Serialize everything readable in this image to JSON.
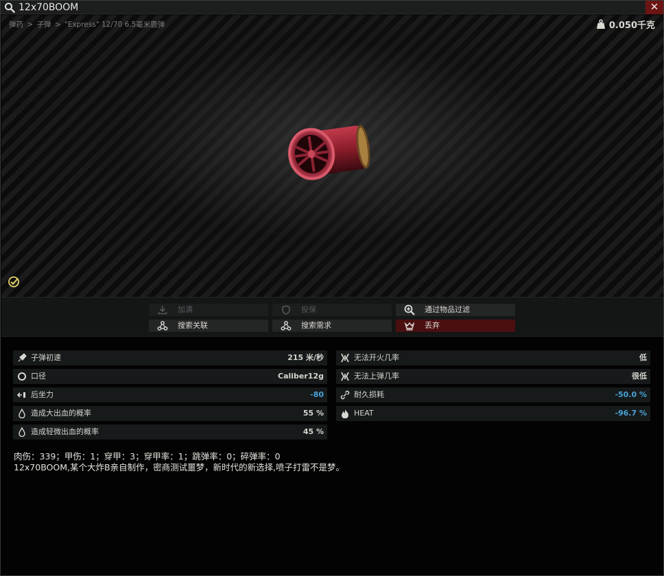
{
  "title": "12x70BOOM",
  "close_symbol": "✕",
  "breadcrumb": [
    "弹药",
    "子弹",
    "\"Express\" 12/70 6.5毫米鹿弹"
  ],
  "breadcrumb_sep": ">",
  "weight": "0.050千克",
  "actions": {
    "add": "加满",
    "insure": "投保",
    "filter": "通过物品过滤",
    "linked": "搜索关联",
    "required": "搜索需求",
    "discard": "丢弃"
  },
  "stats_left": [
    {
      "icon": "bullet-speed-icon",
      "label": "子弹初速",
      "value": "215 米/秒"
    },
    {
      "icon": "caliber-icon",
      "label": "口径",
      "value": "Caliber12g"
    },
    {
      "icon": "recoil-icon",
      "label": "后坐力",
      "value": "-80"
    },
    {
      "icon": "heavy-bleed-icon",
      "label": "造成大出血的概率",
      "value": "55 %"
    },
    {
      "icon": "light-bleed-icon",
      "label": "造成轻微出血的概率",
      "value": "45 %"
    }
  ],
  "stats_right": [
    {
      "icon": "misfire-icon",
      "label": "无法开火几率",
      "value": "低"
    },
    {
      "icon": "failure-to-feed-icon",
      "label": "无法上弹几率",
      "value": "很低"
    },
    {
      "icon": "durability-icon",
      "label": "耐久损耗",
      "value": "-50.0 %"
    },
    {
      "icon": "heat-icon",
      "label": "HEAT",
      "value": "-96.7 %"
    }
  ],
  "description_line1": "肉伤：339；甲伤：1；穿甲：3；穿甲率：1；跳弹率：0；碎弹率：0",
  "description_line2": "12x70BOOM,某个大炸B亲自制作，密商测试噩梦，新时代的新选择,喷子打雷不是梦。",
  "colors": {
    "negative_value": "#4aa3d8",
    "danger_button": "#4b0f0f",
    "close_button": "#6b1414"
  }
}
